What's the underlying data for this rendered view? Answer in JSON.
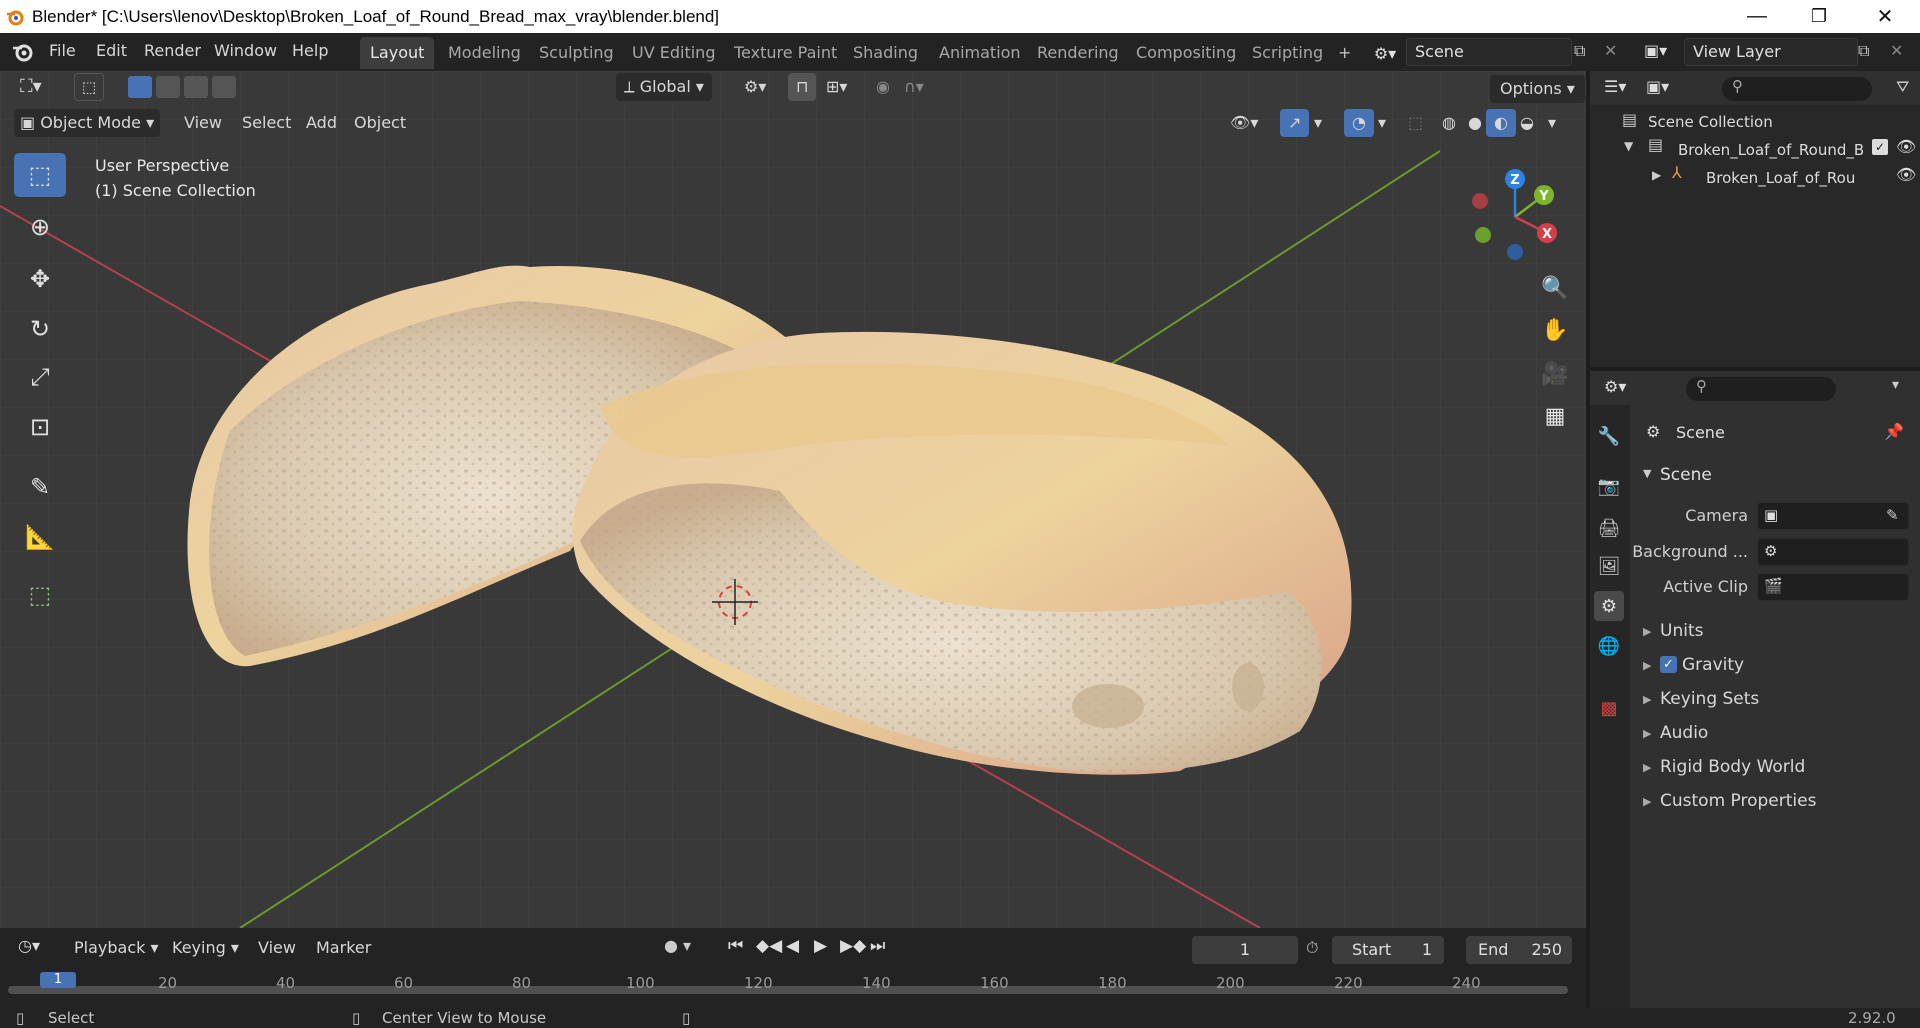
{
  "window": {
    "title": "Blender* [C:\\Users\\lenov\\Desktop\\Broken_Loaf_of_Round_Bread_max_vray\\blender.blend]",
    "minimize": "—",
    "maximize": "❐",
    "close": "✕"
  },
  "menu": {
    "items": [
      "File",
      "Edit",
      "Render",
      "Window",
      "Help"
    ]
  },
  "workspaces": {
    "tabs": [
      "Layout",
      "Modeling",
      "Sculpting",
      "UV Editing",
      "Texture Paint",
      "Shading",
      "Animation",
      "Rendering",
      "Compositing",
      "Scripting"
    ],
    "active": "Layout",
    "add": "+"
  },
  "scene_selector": {
    "value": "Scene"
  },
  "view_layer_selector": {
    "value": "View Layer"
  },
  "viewport_header": {
    "mode": "Object Mode",
    "menus": [
      "View",
      "Select",
      "Add",
      "Object"
    ],
    "transform_orientation": "Global",
    "options": "Options"
  },
  "viewport_overlay": {
    "perspective": "User Perspective",
    "collection": "(1) Scene Collection"
  },
  "gizmo": {
    "z": "Z",
    "y": "Y",
    "x": "X"
  },
  "outliner": {
    "root": "Scene Collection",
    "items": [
      {
        "name": "Broken_Loaf_of_Round_B"
      },
      {
        "name": "Broken_Loaf_of_Rour"
      }
    ]
  },
  "properties": {
    "header": "Scene",
    "panel": "Scene",
    "camera_label": "Camera",
    "background_label": "Background ...",
    "active_clip_label": "Active Clip",
    "sections": [
      "Units",
      "Gravity",
      "Keying Sets",
      "Audio",
      "Rigid Body World",
      "Custom Properties"
    ],
    "gravity_checked": true
  },
  "timeline": {
    "menus": [
      "Playback",
      "Keying",
      "View",
      "Marker"
    ],
    "current_frame": "1",
    "start_label": "Start",
    "start_value": "1",
    "end_label": "End",
    "end_value": "250",
    "ruler": [
      "1",
      "20",
      "40",
      "60",
      "80",
      "100",
      "120",
      "140",
      "160",
      "180",
      "200",
      "220",
      "240"
    ]
  },
  "status": {
    "select": "Select",
    "center_view": "Center View to Mouse",
    "version": "2.92.0"
  },
  "colors": {
    "accent": "#4772b3",
    "axis_x": "#d2404c",
    "axis_y": "#7cb52d",
    "axis_z": "#2f83e0",
    "viewport_bg": "#393939"
  }
}
